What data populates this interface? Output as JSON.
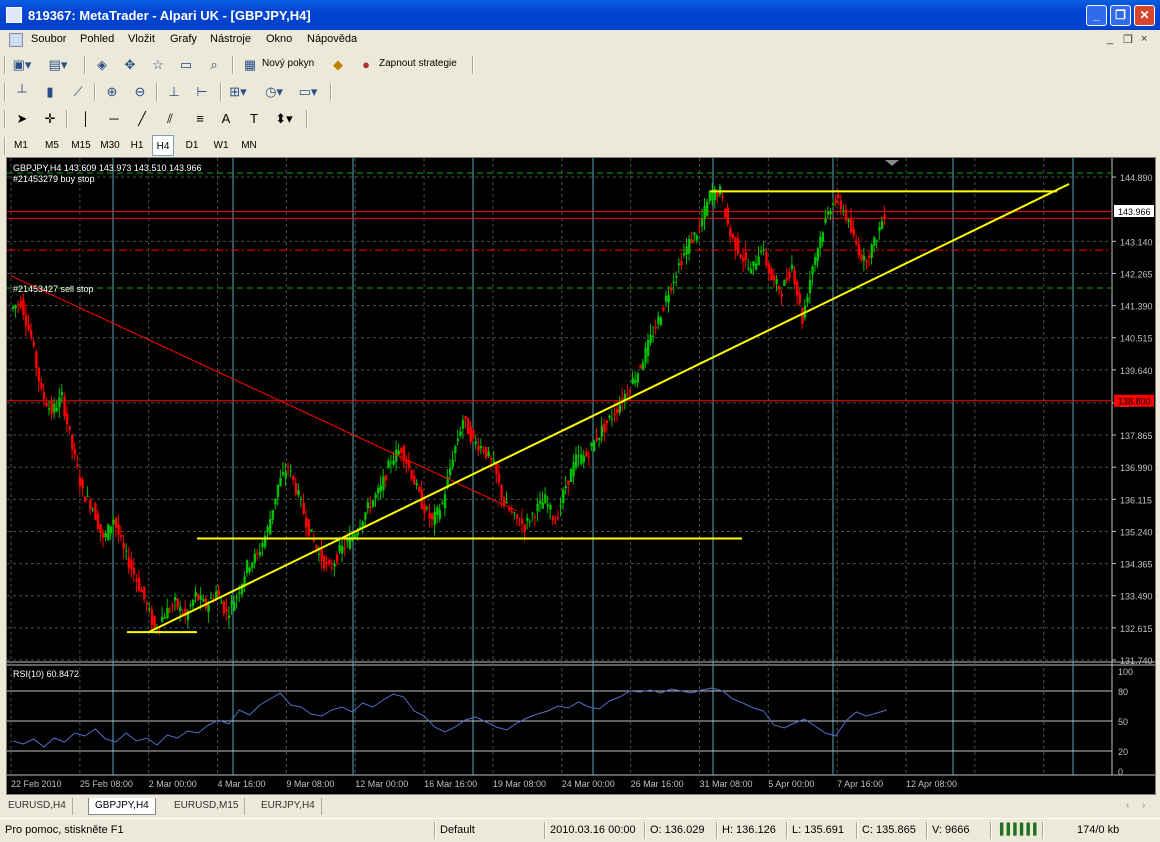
{
  "window": {
    "title": "819367: MetaTrader - Alpari UK - [GBPJPY,H4]",
    "buttons": [
      "_",
      "❐",
      "✕"
    ]
  },
  "menu": {
    "items": [
      "Soubor",
      "Pohled",
      "Vložit",
      "Grafy",
      "Nástroje",
      "Okno",
      "Nápověda"
    ],
    "mdi_controls": [
      "_",
      "❐",
      "×"
    ]
  },
  "toolbar": {
    "new_order_label": "Nový pokyn",
    "strategy_label": "Zapnout strategie"
  },
  "timeframes": {
    "items": [
      "M1",
      "M5",
      "M15",
      "M30",
      "H1",
      "H4",
      "D1",
      "W1",
      "MN"
    ],
    "selected": "H4"
  },
  "chart_data": [
    {
      "type": "candlestick",
      "title": "GBPJPY,H4  143.609 143.973 143.510 143.966",
      "symbol": "GBPJPY",
      "timeframe": "H4",
      "ohlc_header": {
        "open": 143.609,
        "high": 143.973,
        "low": 143.51,
        "close": 143.966
      },
      "ylim": [
        131.74,
        145.3
      ],
      "y_ticks": [
        "144.890",
        "143.966",
        "143.140",
        "142.265",
        "141.390",
        "140.515",
        "139.640",
        "138.740",
        "137.865",
        "136.990",
        "136.115",
        "135.240",
        "134.365",
        "133.490",
        "132.615",
        "131.740"
      ],
      "current_price": "143.966",
      "order_price_label": "138.800",
      "x_ticks": [
        "22 Feb 2010",
        "25 Feb 08:00",
        "2 Mar 00:00",
        "4 Mar 16:00",
        "9 Mar 08:00",
        "12 Mar 00:00",
        "16 Mar 16:00",
        "19 Mar 08:00",
        "24 Mar 00:00",
        "26 Mar 16:00",
        "31 Mar 08:00",
        "5 Apr 00:00",
        "7 Apr 16:00",
        "12 Apr 08:00"
      ],
      "price_path": [
        141.3,
        141.5,
        140.5,
        139.0,
        138.5,
        138.9,
        137.5,
        136.3,
        135.9,
        135.0,
        135.6,
        134.7,
        134.1,
        133.4,
        132.6,
        133.0,
        133.3,
        132.9,
        133.5,
        133.2,
        133.6,
        133.0,
        133.5,
        134.3,
        134.6,
        135.3,
        136.5,
        137.0,
        136.2,
        135.3,
        134.6,
        134.2,
        134.7,
        135.0,
        135.5,
        136.0,
        136.4,
        137.2,
        137.5,
        136.8,
        136.0,
        135.5,
        136.0,
        137.3,
        138.3,
        137.7,
        137.5,
        137.0,
        136.0,
        135.6,
        135.4,
        135.8,
        136.1,
        135.5,
        136.5,
        137.2,
        137.3,
        137.8,
        138.2,
        138.6,
        139.1,
        139.6,
        140.3,
        141.0,
        141.8,
        142.5,
        143.1,
        143.5,
        144.4,
        144.5,
        143.3,
        142.8,
        142.3,
        143.0,
        142.1,
        141.8,
        142.5,
        141.0,
        142.5,
        143.5,
        144.3,
        144.0,
        143.2,
        142.6,
        143.1,
        143.9
      ],
      "annotations": [
        "#21453279 buy stop",
        "#21453427 sell stop"
      ],
      "horizontal_levels": {
        "red_solid": [
          143.95,
          143.77,
          138.8
        ],
        "red_dashdot": [
          142.9
        ],
        "green_dashed": [
          145.0,
          141.87
        ]
      },
      "trendlines_yellow": [
        {
          "from": [
            "2 Mar 00:00",
            132.5
          ],
          "to": [
            "12 Apr 08:00",
            144.7
          ]
        },
        {
          "from": [
            "4 Mar 00:00",
            135.05
          ],
          "to": [
            "5 Apr 16:00",
            135.05
          ]
        },
        {
          "from": [
            "4 Apr 16:00",
            144.5
          ],
          "to": [
            "15 Apr 00:00",
            144.5
          ]
        },
        {
          "from": [
            "1 Mar 00:00",
            132.5
          ],
          "to": [
            "4 Mar 00:00",
            132.5
          ]
        }
      ],
      "trendlines_red": [
        {
          "from": [
            "22 Feb 2010",
            142.2
          ],
          "to": [
            "23 Mar 08:00",
            135.8
          ]
        }
      ],
      "grid": true
    },
    {
      "type": "line",
      "title": "RSI(10) 60.8472",
      "ylim": [
        0,
        100
      ],
      "y_ticks": [
        "100",
        "80",
        "50",
        "20",
        "0"
      ],
      "levels": [
        80,
        50,
        20
      ],
      "values": [
        30,
        27,
        32,
        24,
        33,
        29,
        38,
        35,
        42,
        32,
        29,
        38,
        30,
        33,
        26,
        36,
        33,
        40,
        38,
        46,
        51,
        47,
        61,
        56,
        66,
        72,
        78,
        66,
        64,
        57,
        55,
        61,
        64,
        59,
        68,
        64,
        71,
        77,
        74,
        60,
        55,
        44,
        39,
        44,
        51,
        54,
        49,
        44,
        41,
        48,
        53,
        57,
        60,
        65,
        63,
        69,
        64,
        62,
        70,
        74,
        80,
        79,
        81,
        78,
        82,
        80,
        78,
        81,
        83,
        80,
        72,
        68,
        63,
        60,
        46,
        43,
        48,
        52,
        45,
        38,
        35,
        50,
        59,
        55,
        58,
        61
      ]
    }
  ],
  "tabs": {
    "items": [
      "EURUSD,H4",
      "GBPJPY,H4",
      "EURUSD,M15",
      "EURJPY,H4"
    ],
    "selected": "GBPJPY,H4",
    "scroll_arrows": [
      "‹",
      "›"
    ]
  },
  "status": {
    "help": "Pro pomoc, stiskněte F1",
    "profile": "Default",
    "datetime": "2010.03.16 00:00",
    "open": "O: 136.029",
    "high": "H: 136.126",
    "low": "L: 135.691",
    "close": "C: 135.865",
    "volume": "V: 9666",
    "traffic": "174/0 kb"
  },
  "colors": {
    "bull": "#00c000",
    "bear": "#ff0000",
    "grid": "#4a4f4a",
    "vline": "#5aa7b4",
    "yellow": "#ffff00",
    "rsi": "#4f6fc7"
  }
}
